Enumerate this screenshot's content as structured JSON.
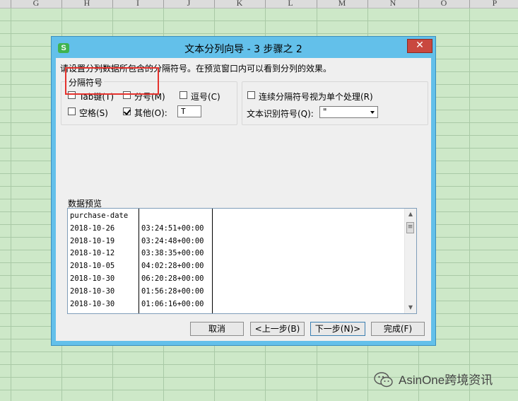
{
  "spreadsheet": {
    "columns": [
      "G",
      "H",
      "I",
      "J",
      "K",
      "L",
      "M",
      "N",
      "O",
      "P"
    ]
  },
  "dialog": {
    "title": "文本分列向导 - 3 步骤之 2",
    "app_icon_letter": "S",
    "close_label": "✕",
    "instruction": "请设置分列数据所包含的分隔符号。在预览窗口内可以看到分列的效果。",
    "delimiters": {
      "legend": "分隔符号",
      "tab": {
        "label": "Tab键(T)",
        "checked": false
      },
      "semicolon": {
        "label": "分号(M)",
        "checked": false
      },
      "comma": {
        "label": "逗号(C)",
        "checked": false
      },
      "space": {
        "label": "空格(S)",
        "checked": false
      },
      "other": {
        "label": "其他(O):",
        "checked": true,
        "value": "T"
      }
    },
    "options": {
      "consecutive_label": "连续分隔符号视为单个处理(R)",
      "consecutive_checked": false,
      "qualifier_label": "文本识别符号(Q):",
      "qualifier_value": "\""
    },
    "preview": {
      "legend": "数据预览",
      "rows": [
        [
          "purchase-date",
          ""
        ],
        [
          "2018-10-26",
          "03:24:51+00:00"
        ],
        [
          "2018-10-19",
          "03:24:48+00:00"
        ],
        [
          "2018-10-12",
          "03:38:35+00:00"
        ],
        [
          "2018-10-05",
          "04:02:28+00:00"
        ],
        [
          "2018-10-30",
          "06:20:28+00:00"
        ],
        [
          "2018-10-30",
          "01:56:28+00:00"
        ],
        [
          "2018-10-30",
          "01:06:16+00:00"
        ]
      ]
    },
    "buttons": {
      "cancel": "取消",
      "back": "<上一步(B)",
      "next": "下一步(N)>",
      "finish": "完成(F)"
    }
  },
  "watermark": {
    "text": "AsinOne跨境资讯"
  }
}
